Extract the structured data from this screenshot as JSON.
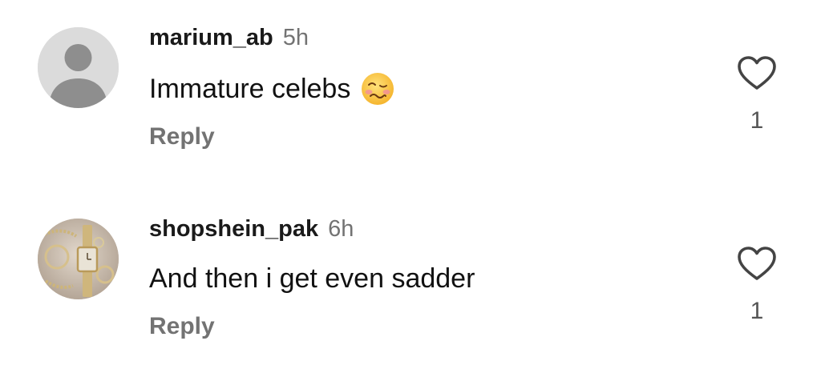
{
  "colors": {
    "username": "#1a1a1a",
    "secondary_text": "#737373",
    "body_text": "#111111",
    "avatar_placeholder_bg": "#dbdbdb",
    "avatar_placeholder_fg": "#8e8e8e"
  },
  "comments": [
    {
      "username": "marium_ab",
      "time": "5h",
      "text": "Immature celebs",
      "emoji": "woozy-face",
      "reply_label": "Reply",
      "like_icon": "heart-outline-icon",
      "likes": "1",
      "avatar": "default-profile-placeholder"
    },
    {
      "username": "shopshein_pak",
      "time": "6h",
      "text": "And then i get even sadder",
      "reply_label": "Reply",
      "like_icon": "heart-outline-icon",
      "likes": "1",
      "avatar": "profile-photo-watch-jewelry"
    }
  ]
}
